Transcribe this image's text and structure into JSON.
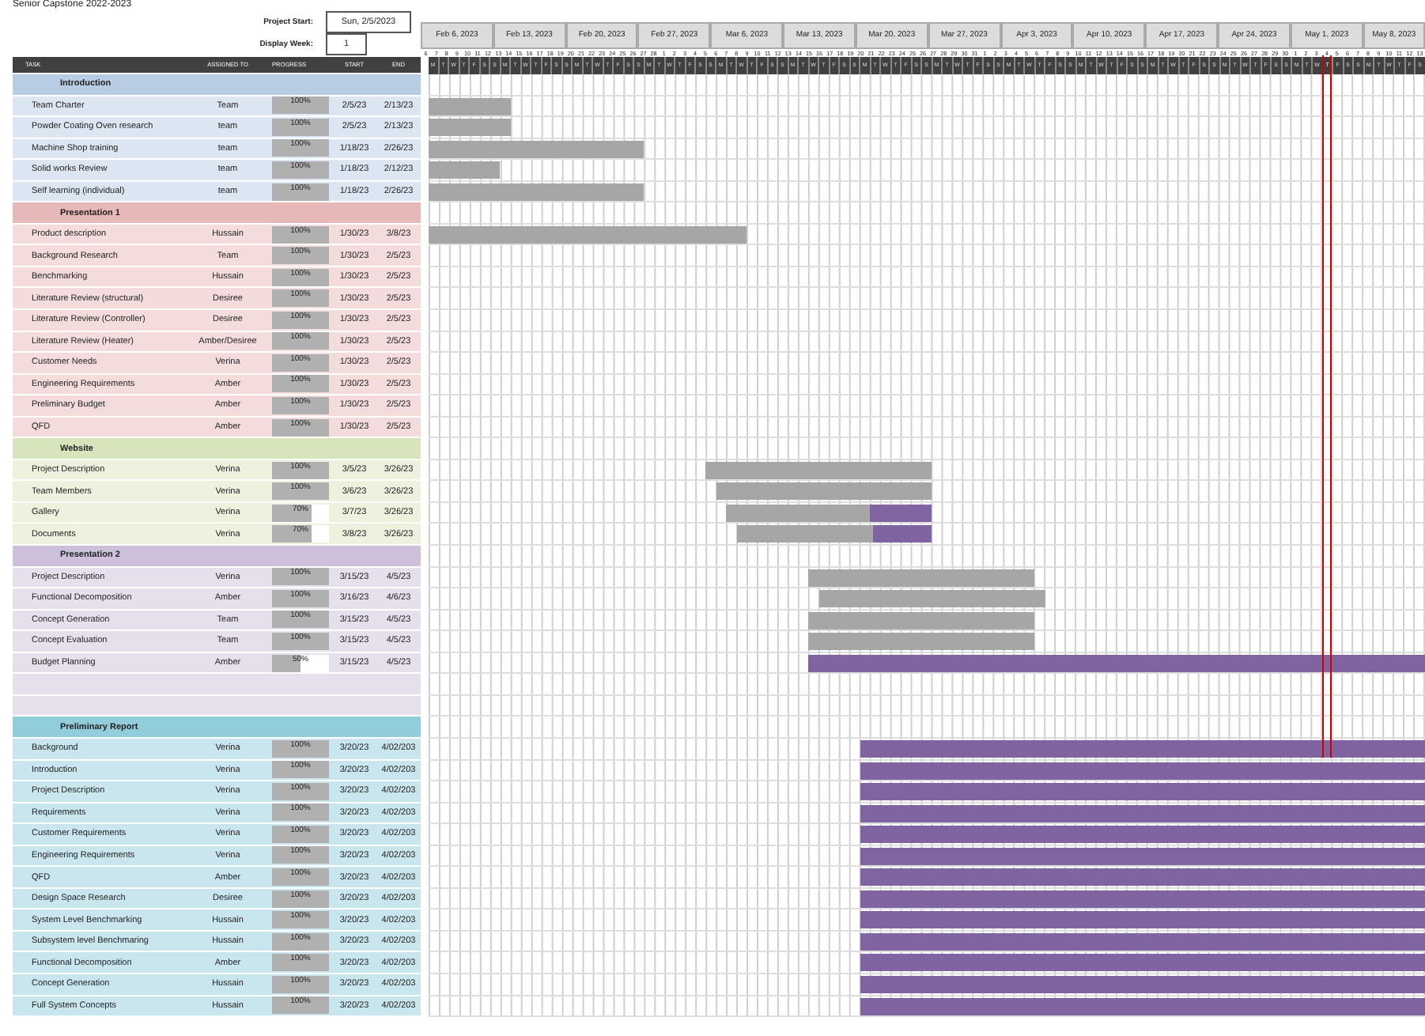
{
  "title": "Senior Capstone 2022-2023",
  "project_start": {
    "label": "Project Start:",
    "value": "Sun, 2/5/2023"
  },
  "display_week": {
    "label": "Display Week:",
    "value": "1"
  },
  "columns": [
    "TASK",
    "ASSIGNED TO",
    "PROGRESS",
    "START",
    "END"
  ],
  "weeks": [
    {
      "label": "Feb 6, 2023",
      "days": [
        {
          "day": "6",
          "weekday": "M",
          "today": false
        },
        {
          "day": "7",
          "weekday": "T",
          "today": false
        },
        {
          "day": "8",
          "weekday": "W",
          "today": false
        },
        {
          "day": "9",
          "weekday": "T",
          "today": false
        },
        {
          "day": "10",
          "weekday": "F",
          "today": false
        },
        {
          "day": "11",
          "weekday": "S",
          "today": false
        },
        {
          "day": "12",
          "weekday": "S",
          "today": false
        }
      ]
    },
    {
      "label": "Feb 13, 2023",
      "days": [
        {
          "day": "13",
          "weekday": "M",
          "today": false
        },
        {
          "day": "14",
          "weekday": "T",
          "today": false
        },
        {
          "day": "15",
          "weekday": "W",
          "today": false
        },
        {
          "day": "16",
          "weekday": "T",
          "today": false
        },
        {
          "day": "17",
          "weekday": "F",
          "today": false
        },
        {
          "day": "18",
          "weekday": "S",
          "today": false
        },
        {
          "day": "19",
          "weekday": "S",
          "today": false
        }
      ]
    },
    {
      "label": "Feb 20, 2023",
      "days": [
        {
          "day": "20",
          "weekday": "M",
          "today": false
        },
        {
          "day": "21",
          "weekday": "T",
          "today": false
        },
        {
          "day": "22",
          "weekday": "W",
          "today": false
        },
        {
          "day": "23",
          "weekday": "T",
          "today": false
        },
        {
          "day": "24",
          "weekday": "F",
          "today": false
        },
        {
          "day": "25",
          "weekday": "S",
          "today": false
        },
        {
          "day": "26",
          "weekday": "S",
          "today": false
        }
      ]
    },
    {
      "label": "Feb 27, 2023",
      "days": [
        {
          "day": "27",
          "weekday": "M",
          "today": false
        },
        {
          "day": "28",
          "weekday": "T",
          "today": false
        },
        {
          "day": "1",
          "weekday": "W",
          "today": false
        },
        {
          "day": "2",
          "weekday": "T",
          "today": false
        },
        {
          "day": "3",
          "weekday": "F",
          "today": false
        },
        {
          "day": "4",
          "weekday": "S",
          "today": false
        },
        {
          "day": "5",
          "weekday": "S",
          "today": false
        }
      ]
    },
    {
      "label": "Mar 6, 2023",
      "days": [
        {
          "day": "6",
          "weekday": "M",
          "today": false
        },
        {
          "day": "7",
          "weekday": "T",
          "today": false
        },
        {
          "day": "8",
          "weekday": "W",
          "today": false
        },
        {
          "day": "9",
          "weekday": "T",
          "today": false
        },
        {
          "day": "10",
          "weekday": "F",
          "today": false
        },
        {
          "day": "11",
          "weekday": "S",
          "today": false
        },
        {
          "day": "12",
          "weekday": "S",
          "today": false
        }
      ]
    },
    {
      "label": "Mar 13, 2023",
      "days": [
        {
          "day": "13",
          "weekday": "M",
          "today": false
        },
        {
          "day": "14",
          "weekday": "T",
          "today": false
        },
        {
          "day": "15",
          "weekday": "W",
          "today": false
        },
        {
          "day": "16",
          "weekday": "T",
          "today": false
        },
        {
          "day": "17",
          "weekday": "F",
          "today": false
        },
        {
          "day": "18",
          "weekday": "S",
          "today": false
        },
        {
          "day": "19",
          "weekday": "S",
          "today": false
        }
      ]
    },
    {
      "label": "Mar 20, 2023",
      "days": [
        {
          "day": "20",
          "weekday": "M",
          "today": false
        },
        {
          "day": "21",
          "weekday": "T",
          "today": false
        },
        {
          "day": "22",
          "weekday": "W",
          "today": false
        },
        {
          "day": "23",
          "weekday": "T",
          "today": false
        },
        {
          "day": "24",
          "weekday": "F",
          "today": false
        },
        {
          "day": "25",
          "weekday": "S",
          "today": false
        },
        {
          "day": "26",
          "weekday": "S",
          "today": false
        }
      ]
    },
    {
      "label": "Mar 27, 2023",
      "days": [
        {
          "day": "27",
          "weekday": "M",
          "today": false
        },
        {
          "day": "28",
          "weekday": "T",
          "today": false
        },
        {
          "day": "29",
          "weekday": "W",
          "today": false
        },
        {
          "day": "30",
          "weekday": "T",
          "today": false
        },
        {
          "day": "31",
          "weekday": "F",
          "today": false
        },
        {
          "day": "1",
          "weekday": "S",
          "today": false
        },
        {
          "day": "2",
          "weekday": "S",
          "today": false
        }
      ]
    },
    {
      "label": "Apr 3, 2023",
      "days": [
        {
          "day": "3",
          "weekday": "M",
          "today": false
        },
        {
          "day": "4",
          "weekday": "T",
          "today": false
        },
        {
          "day": "5",
          "weekday": "W",
          "today": false
        },
        {
          "day": "6",
          "weekday": "T",
          "today": false
        },
        {
          "day": "7",
          "weekday": "F",
          "today": false
        },
        {
          "day": "8",
          "weekday": "S",
          "today": false
        },
        {
          "day": "9",
          "weekday": "S",
          "today": false
        }
      ]
    },
    {
      "label": "Apr 10, 2023",
      "days": [
        {
          "day": "10",
          "weekday": "M",
          "today": false
        },
        {
          "day": "11",
          "weekday": "T",
          "today": false
        },
        {
          "day": "12",
          "weekday": "W",
          "today": false
        },
        {
          "day": "13",
          "weekday": "T",
          "today": false
        },
        {
          "day": "14",
          "weekday": "F",
          "today": false
        },
        {
          "day": "15",
          "weekday": "S",
          "today": false
        },
        {
          "day": "16",
          "weekday": "S",
          "today": false
        }
      ]
    },
    {
      "label": "Apr 17, 2023",
      "days": [
        {
          "day": "17",
          "weekday": "M",
          "today": false
        },
        {
          "day": "18",
          "weekday": "T",
          "today": false
        },
        {
          "day": "19",
          "weekday": "W",
          "today": false
        },
        {
          "day": "20",
          "weekday": "T",
          "today": false
        },
        {
          "day": "21",
          "weekday": "F",
          "today": false
        },
        {
          "day": "22",
          "weekday": "S",
          "today": false
        },
        {
          "day": "23",
          "weekday": "S",
          "today": false
        }
      ]
    },
    {
      "label": "Apr 24, 2023",
      "days": [
        {
          "day": "24",
          "weekday": "M",
          "today": false
        },
        {
          "day": "25",
          "weekday": "T",
          "today": false
        },
        {
          "day": "26",
          "weekday": "W",
          "today": false
        },
        {
          "day": "27",
          "weekday": "T",
          "today": false
        },
        {
          "day": "28",
          "weekday": "F",
          "today": false
        },
        {
          "day": "29",
          "weekday": "S",
          "today": false
        },
        {
          "day": "30",
          "weekday": "S",
          "today": false
        }
      ]
    },
    {
      "label": "May 1, 2023",
      "days": [
        {
          "day": "1",
          "weekday": "M",
          "today": false
        },
        {
          "day": "2",
          "weekday": "T",
          "today": false
        },
        {
          "day": "3",
          "weekday": "W",
          "today": false
        },
        {
          "day": "4",
          "weekday": "T",
          "today": true
        },
        {
          "day": "5",
          "weekday": "F",
          "today": false
        },
        {
          "day": "6",
          "weekday": "S",
          "today": false
        },
        {
          "day": "7",
          "weekday": "S",
          "today": false
        }
      ]
    },
    {
      "label": "May 8, 2023",
      "days": [
        {
          "day": "8",
          "weekday": "M",
          "today": false
        },
        {
          "day": "9",
          "weekday": "T",
          "today": false
        },
        {
          "day": "10",
          "weekday": "W",
          "today": false
        },
        {
          "day": "11",
          "weekday": "T",
          "today": false
        },
        {
          "day": "12",
          "weekday": "F",
          "today": false
        },
        {
          "day": "13",
          "weekday": "S",
          "today": false
        }
      ]
    }
  ],
  "sections": [
    {
      "title": "Introduction",
      "color": "#b8cce4",
      "tasks": [
        {
          "kind": "tracked",
          "name": "Team Charter",
          "assigned": "Team",
          "progress": "100%",
          "level": 1,
          "start": "2/5/23",
          "end": "2/13/23"
        },
        {
          "kind": "tracked",
          "name": "Powder Coating Oven research",
          "assigned": "team",
          "progress": "100%",
          "level": 1,
          "start": "2/5/23",
          "end": "2/13/23"
        },
        {
          "kind": "tracked",
          "name": "Machine Shop training",
          "assigned": "team",
          "progress": "100%",
          "level": 1,
          "start": "1/18/23",
          "end": "2/26/23"
        },
        {
          "kind": "tracked",
          "name": "Solid works Review",
          "assigned": "team",
          "progress": "100%",
          "level": 1,
          "start": "1/18/23",
          "end": "2/12/23"
        },
        {
          "kind": "tracked",
          "name": "Self learning (individual)",
          "assigned": "team",
          "progress": "100%",
          "level": 1,
          "start": "1/18/23",
          "end": "2/26/23"
        }
      ]
    },
    {
      "title": "Presentation 1",
      "color": "#e6b8b7",
      "tasks": [
        {
          "kind": "tracked",
          "name": "Product description",
          "assigned": "Hussain",
          "progress": "100%",
          "level": 1,
          "start": "1/30/23",
          "end": "3/8/23"
        },
        {
          "kind": "tracked",
          "name": "Background Research",
          "assigned": "Team",
          "progress": "100%",
          "level": 1,
          "start": "1/30/23",
          "end": "2/5/23"
        },
        {
          "kind": "tracked",
          "name": "Benchmarking",
          "assigned": "Hussain",
          "progress": "100%",
          "level": 1,
          "start": "1/30/23",
          "end": "2/5/23"
        },
        {
          "kind": "tracked",
          "name": "Literature Review (structural)",
          "assigned": "Desiree",
          "progress": "100%",
          "level": 1,
          "start": "1/30/23",
          "end": "2/5/23"
        },
        {
          "kind": "tracked",
          "name": "Literature Review (Controller)",
          "assigned": "Desiree",
          "progress": "100%",
          "level": 1,
          "start": "1/30/23",
          "end": "2/5/23"
        },
        {
          "kind": "tracked",
          "name": "Literature Review (Heater)",
          "assigned": "Amber/Desiree",
          "progress": "100%",
          "level": 1,
          "start": "1/30/23",
          "end": "2/5/23"
        },
        {
          "kind": "tracked",
          "name": "Customer Needs",
          "assigned": "Verina",
          "progress": "100%",
          "level": 1,
          "start": "1/30/23",
          "end": "2/5/23"
        },
        {
          "kind": "tracked",
          "name": "Engineering Requirements",
          "assigned": "Amber",
          "progress": "100%",
          "level": 1,
          "start": "1/30/23",
          "end": "2/5/23"
        },
        {
          "kind": "tracked",
          "name": "Preliminary Budget",
          "assigned": "Amber",
          "progress": "100%",
          "level": 1,
          "start": "1/30/23",
          "end": "2/5/23"
        },
        {
          "kind": "tracked",
          "name": "QFD",
          "assigned": "Amber",
          "progress": "100%",
          "level": 1,
          "start": "1/30/23",
          "end": "2/5/23"
        }
      ]
    },
    {
      "title": "Website",
      "color": "#d8e4bc",
      "tasks": [
        {
          "kind": "tracked",
          "name": "Project Description",
          "assigned": "Verina",
          "progress": "100%",
          "level": 1,
          "start": "3/5/23",
          "end": "3/26/23"
        },
        {
          "kind": "tracked",
          "name": "Team Members",
          "assigned": "Verina",
          "progress": "100%",
          "level": 1,
          "start": "3/6/23",
          "end": "3/26/23"
        },
        {
          "kind": "tracked",
          "name": "Gallery",
          "assigned": "Verina",
          "progress": "70%",
          "level": 0.7,
          "start": "3/7/23",
          "end": "3/26/23"
        },
        {
          "kind": "tracked",
          "name": "Documents",
          "assigned": "Verina",
          "progress": "70%",
          "level": 0.7,
          "start": "3/8/23",
          "end": "3/26/23"
        }
      ]
    },
    {
      "title": "Presentation 2",
      "color": "#ccc0da",
      "tasks": [
        {
          "kind": "tracked",
          "name": "Project Description",
          "assigned": "Verina",
          "progress": "100%",
          "level": 1,
          "start": "3/15/23",
          "end": "4/5/23"
        },
        {
          "kind": "tracked",
          "name": "Functional Decomposition",
          "assigned": "Amber",
          "progress": "100%",
          "level": 1,
          "start": "3/16/23",
          "end": "4/6/23"
        },
        {
          "kind": "tracked",
          "name": "Concept Generation",
          "assigned": "Team",
          "progress": "100%",
          "level": 1,
          "start": "3/15/23",
          "end": "4/5/23"
        },
        {
          "kind": "tracked",
          "name": "Concept Evaluation",
          "assigned": "Team",
          "progress": "100%",
          "level": 1,
          "start": "3/15/23",
          "end": "4/5/23"
        },
        {
          "kind": "ongoing",
          "name": "Budget Planning",
          "assigned": "Amber",
          "progress": "50%",
          "level": 0.5,
          "start": "3/15/23",
          "end": "4/5/23"
        },
        {
          "kind": "blank"
        },
        {
          "kind": "blank"
        }
      ]
    },
    {
      "title": "Preliminary Report",
      "color": "#92cddc",
      "tasks": [
        {
          "kind": "ongoing",
          "name": "Background",
          "assigned": "Verina",
          "progress": "100%",
          "level": 1,
          "start": "3/20/23",
          "end": "4/02/203"
        },
        {
          "kind": "ongoing",
          "name": "Introduction",
          "assigned": "Verina",
          "progress": "100%",
          "level": 1,
          "start": "3/20/23",
          "end": "4/02/203"
        },
        {
          "kind": "ongoing",
          "name": "Project Description",
          "assigned": "Verina",
          "progress": "100%",
          "level": 1,
          "start": "3/20/23",
          "end": "4/02/203"
        },
        {
          "kind": "ongoing",
          "name": "Requirements",
          "assigned": "Verina",
          "progress": "100%",
          "level": 1,
          "start": "3/20/23",
          "end": "4/02/203"
        },
        {
          "kind": "ongoing",
          "name": "Customer Requirements",
          "assigned": "Verina",
          "progress": "100%",
          "level": 1,
          "start": "3/20/23",
          "end": "4/02/203"
        },
        {
          "kind": "ongoing",
          "name": "Engineering Requirements",
          "assigned": "Verina",
          "progress": "100%",
          "level": 1,
          "start": "3/20/23",
          "end": "4/02/203"
        },
        {
          "kind": "ongoing",
          "name": "QFD",
          "assigned": "Amber",
          "progress": "100%",
          "level": 1,
          "start": "3/20/23",
          "end": "4/02/203"
        },
        {
          "kind": "ongoing",
          "name": "Design Space Research",
          "assigned": "Desiree",
          "progress": "100%",
          "level": 1,
          "start": "3/20/23",
          "end": "4/02/203"
        },
        {
          "kind": "ongoing",
          "name": "System Level Benchmarking",
          "assigned": "Hussain",
          "progress": "100%",
          "level": 1,
          "start": "3/20/23",
          "end": "4/02/203"
        },
        {
          "kind": "ongoing",
          "name": "Subsystem level Benchmaring",
          "assigned": "Hussain",
          "progress": "100%",
          "level": 1,
          "start": "3/20/23",
          "end": "4/02/203"
        },
        {
          "kind": "ongoing",
          "name": "Functional Decomposition",
          "assigned": "Amber",
          "progress": "100%",
          "level": 1,
          "start": "3/20/23",
          "end": "4/02/203"
        },
        {
          "kind": "ongoing",
          "name": "Concept Generation",
          "assigned": "Hussain",
          "progress": "100%",
          "level": 1,
          "start": "3/20/23",
          "end": "4/02/203"
        },
        {
          "kind": "ongoing",
          "name": "Full System Concepts",
          "assigned": "Hussain",
          "progress": "100%",
          "level": 1,
          "start": "3/20/23",
          "end": "4/02/203"
        }
      ]
    }
  ]
}
